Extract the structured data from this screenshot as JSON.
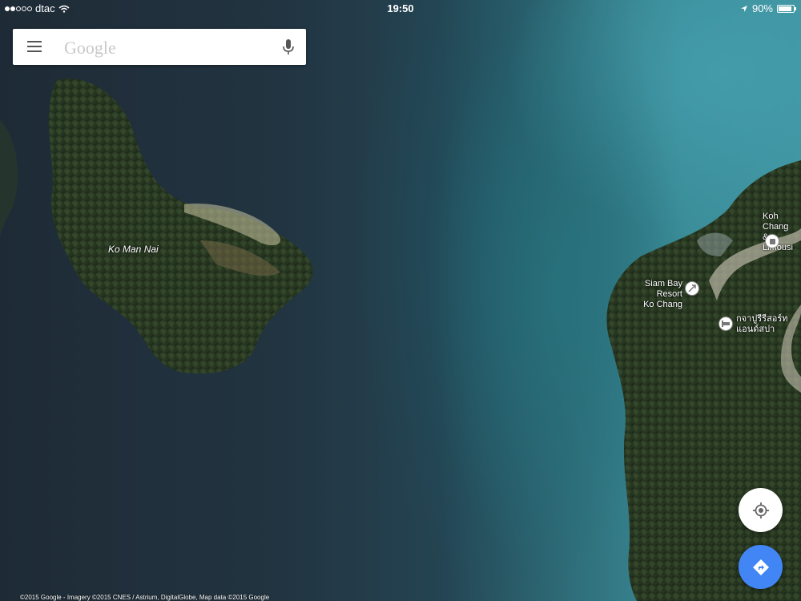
{
  "status_bar": {
    "carrier": "dtac",
    "time": "19:50",
    "battery": "90%",
    "battery_level": 0.9,
    "signal_bars_filled": 2,
    "signal_bars_total": 5
  },
  "search": {
    "placeholder": "Google",
    "menu_icon": "hamburger-menu-icon",
    "voice_icon": "microphone-icon"
  },
  "map": {
    "view": "satellite",
    "island_label": "Ko Man Nai",
    "pois": [
      {
        "label_line1": "Koh Chang",
        "label_line2": "& Limousi",
        "icon": "bus-stop-icon"
      },
      {
        "label_line1": "Siam Bay Resort",
        "label_line2": "Ko Chang",
        "icon": "resort-icon"
      },
      {
        "label_line1": "กจาปูรีรีสอร์ท",
        "label_line2": "แอนด์สปา",
        "icon": "hotel-icon"
      }
    ]
  },
  "controls": {
    "my_location_icon": "my-location-icon",
    "directions_icon": "directions-icon",
    "directions_color": "#4285f4"
  },
  "attribution": "©2015 Google - Imagery ©2015 CNES / Astrium, DigitalGlobe, Map data ©2015 Google"
}
